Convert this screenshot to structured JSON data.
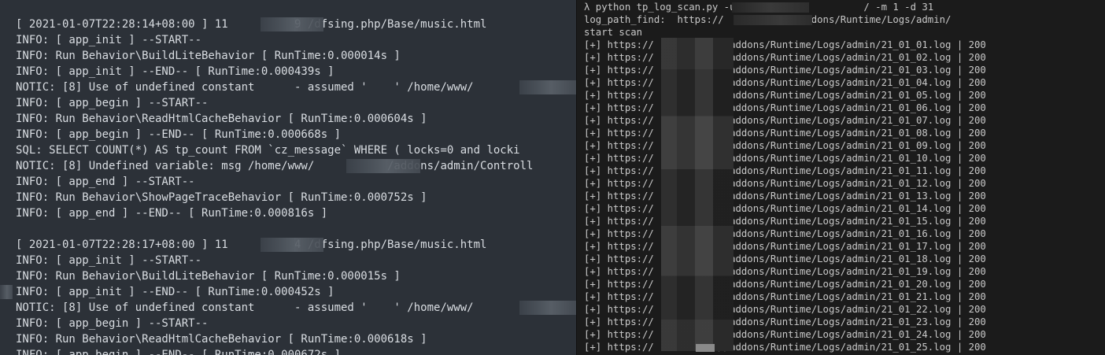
{
  "log_viewer": {
    "lines": [
      "[ 2021-01-07T22:28:14+08:00 ] 11          9 /dfsing.php/Base/music.html",
      "INFO: [ app_init ] --START--",
      "INFO: Run Behavior\\BuildLiteBehavior [ RunTime:0.000014s ]",
      "INFO: [ app_init ] --END-- [ RunTime:0.000439s ]",
      "NOTIC: [8] Use of undefined constant      - assumed '    ' /home/www/",
      "INFO: [ app_begin ] --START--",
      "INFO: Run Behavior\\ReadHtmlCacheBehavior [ RunTime:0.000604s ]",
      "INFO: [ app_begin ] --END-- [ RunTime:0.000668s ]",
      "SQL: SELECT COUNT(*) AS tp_count FROM `cz_message` WHERE ( locks=0 and locki",
      "NOTIC: [8] Undefined variable: msg /home/www/           /addons/admin/Controll",
      "INFO: [ app_end ] --START--",
      "INFO: Run Behavior\\ShowPageTraceBehavior [ RunTime:0.000752s ]",
      "INFO: [ app_end ] --END-- [ RunTime:0.000816s ]",
      "",
      "[ 2021-01-07T22:28:17+08:00 ] 11          4 /dfsing.php/Base/music.html",
      "INFO: [ app_init ] --START--",
      "INFO: Run Behavior\\BuildLiteBehavior [ RunTime:0.000015s ]",
      "INFO: [ app_init ] --END-- [ RunTime:0.000452s ]",
      "NOTIC: [8] Use of undefined constant      - assumed '    ' /home/www/",
      "INFO: [ app_begin ] --START--",
      "INFO: Run Behavior\\ReadHtmlCacheBehavior [ RunTime:0.000618s ]",
      "INFO: [ app_begin ] --END-- [ RunTime:0.000672s ]"
    ]
  },
  "terminal": {
    "header_lines": [
      "λ python tp_log_scan.py -u https://             / -m 1 -d 31",
      "log_path_find:  https://           //addons/Runtime/Logs/admin/",
      "start scan"
    ],
    "result_lines": [
      "[+] https://           //addons/Runtime/Logs/admin/21_01_01.log | 200",
      "[+] https://           //addons/Runtime/Logs/admin/21_01_02.log | 200",
      "[+] https://           //addons/Runtime/Logs/admin/21_01_03.log | 200",
      "[+] https://           //addons/Runtime/Logs/admin/21_01_04.log | 200",
      "[+] https://           //addons/Runtime/Logs/admin/21_01_05.log | 200",
      "[+] https://           //addons/Runtime/Logs/admin/21_01_06.log | 200",
      "[+] https://           //addons/Runtime/Logs/admin/21_01_07.log | 200",
      "[+] https://           //addons/Runtime/Logs/admin/21_01_08.log | 200",
      "[+] https://           //addons/Runtime/Logs/admin/21_01_09.log | 200",
      "[+] https://           //addons/Runtime/Logs/admin/21_01_10.log | 200",
      "[+] https://           //addons/Runtime/Logs/admin/21_01_11.log | 200",
      "[+] https://           //addons/Runtime/Logs/admin/21_01_12.log | 200",
      "[+] https://           //addons/Runtime/Logs/admin/21_01_13.log | 200",
      "[+] https://           //addons/Runtime/Logs/admin/21_01_14.log | 200",
      "[+] https://           //addons/Runtime/Logs/admin/21_01_15.log | 200",
      "[+] https://           //addons/Runtime/Logs/admin/21_01_16.log | 200",
      "[+] https://           //addons/Runtime/Logs/admin/21_01_17.log | 200",
      "[+] https://           //addons/Runtime/Logs/admin/21_01_18.log | 200",
      "[+] https://           //addons/Runtime/Logs/admin/21_01_19.log | 200",
      "[+] https://           //addons/Runtime/Logs/admin/21_01_20.log | 200",
      "[+] https://           //addons/Runtime/Logs/admin/21_01_21.log | 200",
      "[+] https://           //addons/Runtime/Logs/admin/21_01_22.log | 200",
      "[+] https://           //addons/Runtime/Logs/admin/21_01_23.log | 200",
      "[+] https://           //addons/Runtime/Logs/admin/21_01_24.log | 200",
      "[+] https://           //addons/Runtime/Logs/admin/21_01_25.log | 200"
    ]
  },
  "colors": {
    "log_bg": "#2c3138",
    "log_text": "#d9dde2",
    "terminal_bg": "#1b1b1b",
    "terminal_text": "#c8c8c8"
  }
}
